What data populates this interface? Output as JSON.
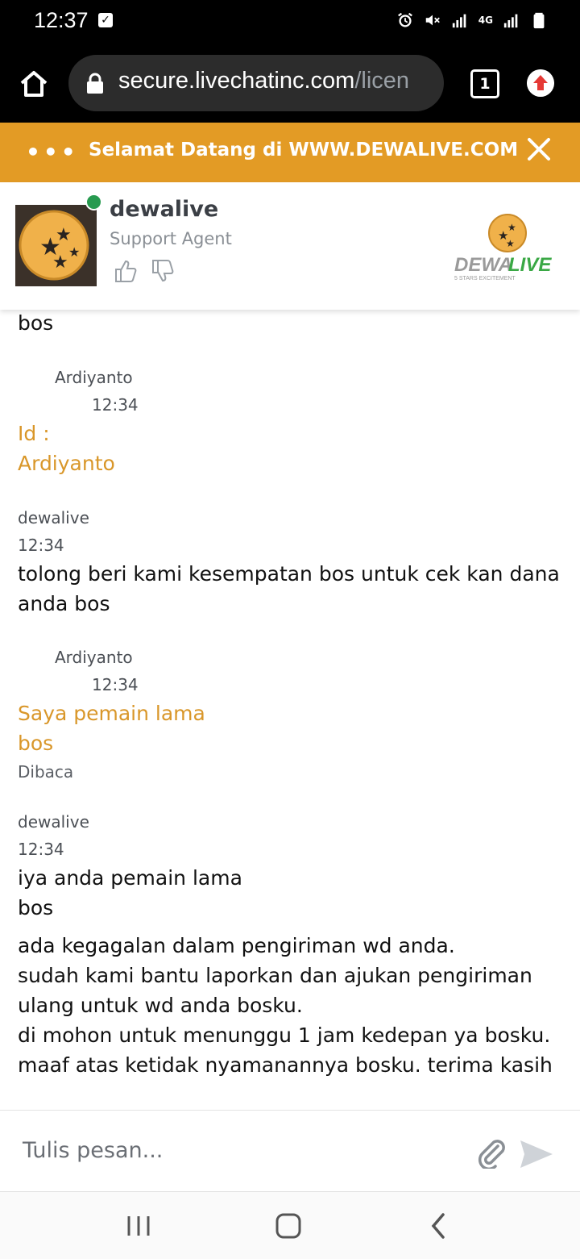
{
  "status_bar": {
    "time": "12:37",
    "network": "4G"
  },
  "browser": {
    "url_main": "secure.livechatinc.com",
    "url_dim": "/licen",
    "tab_count": "1"
  },
  "banner": {
    "menu_glyph": "•••",
    "title": "Selamat Datang di WWW.DEWALIVE.COM"
  },
  "agent": {
    "name": "dewalive",
    "role": "Support Agent",
    "status": "online"
  },
  "brand": {
    "name_part1": "DEWA",
    "name_part2": "LIVE",
    "tagline": "5 STARS EXCITEMENT"
  },
  "chat": {
    "messages": [
      {
        "author": "",
        "time": "",
        "lines": [
          "bos"
        ],
        "side": "agent"
      },
      {
        "author": "Ardiyanto",
        "time": "12:34",
        "lines": [
          "Id :",
          "Ardiyanto"
        ],
        "side": "visitor"
      },
      {
        "author": "dewalive",
        "time": "12:34",
        "lines": [
          "tolong beri kami kesempatan bos untuk cek kan dana",
          "anda bos"
        ],
        "side": "agent"
      },
      {
        "author": "Ardiyanto",
        "time": "12:34",
        "lines": [
          "Saya pemain lama",
          "bos"
        ],
        "side": "visitor",
        "receipt": "Dibaca"
      },
      {
        "author": "dewalive",
        "time": "12:34",
        "lines": [
          "iya anda pemain lama",
          "bos"
        ],
        "side": "agent"
      },
      {
        "author": "",
        "time": "",
        "lines": [
          "ada kegagalan dalam pengiriman wd anda.",
          "sudah kami bantu laporkan dan ajukan pengiriman",
          "ulang untuk wd anda bosku.",
          "di mohon untuk menunggu 1 jam kedepan ya bosku.",
          "maaf atas ketidak nyamanannya bosku. terima kasih"
        ],
        "side": "agent"
      }
    ]
  },
  "composer": {
    "placeholder": "Tulis pesan..."
  },
  "colors": {
    "banner": "#e39b25",
    "visitor_text": "#d9972a",
    "online": "#279a4f"
  }
}
